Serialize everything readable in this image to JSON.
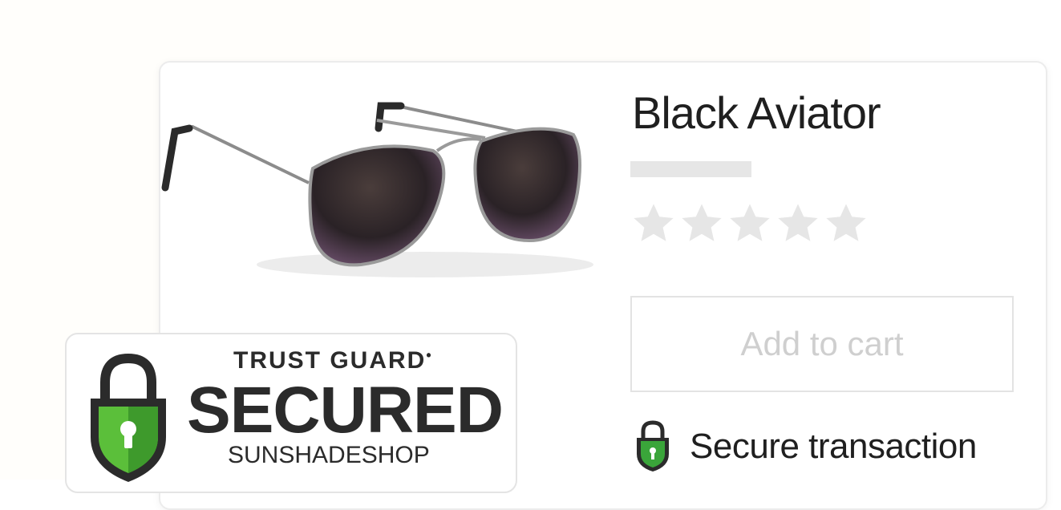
{
  "product": {
    "title": "Black Aviator",
    "image_icon": "aviator-sunglasses",
    "rating_stars_filled": 0,
    "rating_stars_total": 5,
    "star_color": "#e6e6e6"
  },
  "actions": {
    "add_to_cart_label": "Add to cart"
  },
  "security": {
    "secure_transaction_label": "Secure transaction",
    "shield_icon": "shield-lock-icon",
    "shield_color": "#3aa53a"
  },
  "trust_badge": {
    "brand": "TRUST GUARD",
    "brand_mark": "•",
    "status": "SECURED",
    "shop_name": "SUNSHADESHOP",
    "lock_icon": "padlock-shield-icon"
  }
}
